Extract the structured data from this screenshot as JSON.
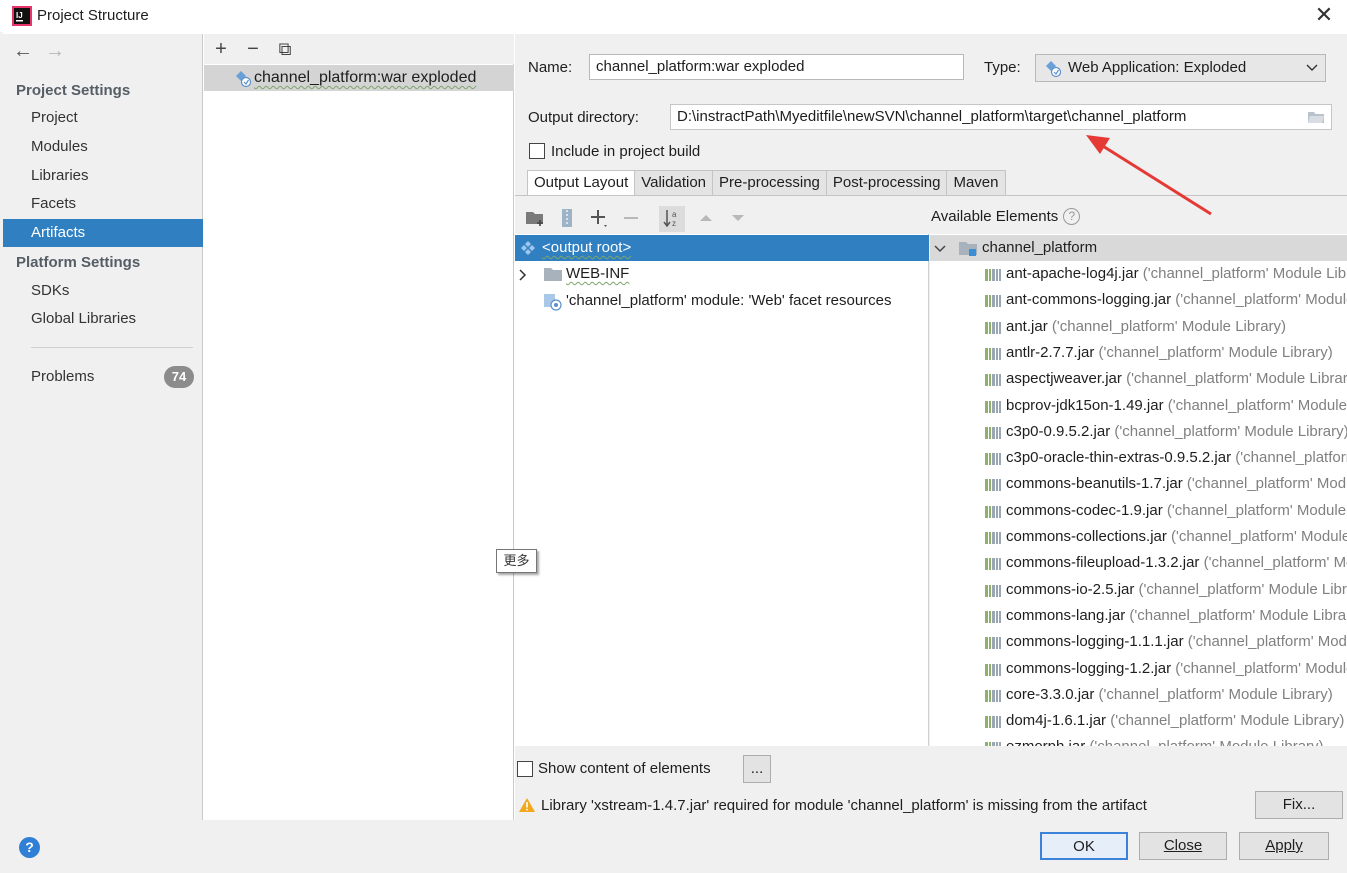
{
  "window": {
    "title": "Project Structure",
    "close": "✕"
  },
  "sidebar": {
    "back": "←",
    "forward": "→",
    "project_settings_header": "Project Settings",
    "project_items": [
      {
        "label": "Project"
      },
      {
        "label": "Modules"
      },
      {
        "label": "Libraries"
      },
      {
        "label": "Facets"
      },
      {
        "label": "Artifacts",
        "selected": true
      }
    ],
    "platform_settings_header": "Platform Settings",
    "platform_items": [
      {
        "label": "SDKs"
      },
      {
        "label": "Global Libraries"
      }
    ],
    "problems": {
      "label": "Problems",
      "count": "74"
    }
  },
  "artifacts_panel": {
    "add": "+",
    "remove": "−",
    "copy": "⧉",
    "items": [
      {
        "label": "channel_platform:war exploded"
      }
    ]
  },
  "detail": {
    "name_label": "Name:",
    "name_value": "channel_platform:war exploded",
    "type_label": "Type:",
    "type_value": "Web Application: Exploded",
    "output_dir_label": "Output directory:",
    "output_dir_value": "D:\\instractPath\\Myeditfile\\newSVN\\channel_platform\\target\\channel_platform",
    "include_label": "Include in project build",
    "include_checked": false,
    "tabs": [
      {
        "label": "Output Layout",
        "active": true
      },
      {
        "label": "Validation"
      },
      {
        "label": "Pre-processing"
      },
      {
        "label": "Post-processing"
      },
      {
        "label": "Maven"
      }
    ]
  },
  "layout_tree": {
    "rows": [
      {
        "label": "<output root>",
        "selected": true
      },
      {
        "label": "WEB-INF"
      },
      {
        "label": "'channel_platform' module: 'Web' facet resources"
      }
    ]
  },
  "available": {
    "header": "Available Elements",
    "help": "?",
    "root": "channel_platform",
    "items": [
      {
        "name": "ant-apache-log4j.jar",
        "suffix": " ('channel_platform' Module Library)"
      },
      {
        "name": "ant-commons-logging.jar",
        "suffix": " ('channel_platform' Module Library)"
      },
      {
        "name": "ant.jar",
        "suffix": " ('channel_platform' Module Library)"
      },
      {
        "name": "antlr-2.7.7.jar",
        "suffix": " ('channel_platform' Module Library)"
      },
      {
        "name": "aspectjweaver.jar",
        "suffix": " ('channel_platform' Module Library)"
      },
      {
        "name": "bcprov-jdk15on-1.49.jar",
        "suffix": " ('channel_platform' Module Library)"
      },
      {
        "name": "c3p0-0.9.5.2.jar",
        "suffix": " ('channel_platform' Module Library)"
      },
      {
        "name": "c3p0-oracle-thin-extras-0.9.5.2.jar",
        "suffix": " ('channel_platform' Module Library)"
      },
      {
        "name": "commons-beanutils-1.7.jar",
        "suffix": " ('channel_platform' Module Library)"
      },
      {
        "name": "commons-codec-1.9.jar",
        "suffix": " ('channel_platform' Module Library)"
      },
      {
        "name": "commons-collections.jar",
        "suffix": " ('channel_platform' Module Library)"
      },
      {
        "name": "commons-fileupload-1.3.2.jar",
        "suffix": " ('channel_platform' Module Library)"
      },
      {
        "name": "commons-io-2.5.jar",
        "suffix": " ('channel_platform' Module Library)"
      },
      {
        "name": "commons-lang.jar",
        "suffix": " ('channel_platform' Module Library)"
      },
      {
        "name": "commons-logging-1.1.1.jar",
        "suffix": " ('channel_platform' Module Library)"
      },
      {
        "name": "commons-logging-1.2.jar",
        "suffix": " ('channel_platform' Module Library)"
      },
      {
        "name": "core-3.3.0.jar",
        "suffix": " ('channel_platform' Module Library)"
      },
      {
        "name": "dom4j-1.6.1.jar",
        "suffix": " ('channel_platform' Module Library)"
      },
      {
        "name": "ezmorph.jar",
        "suffix": " ('channel_platform' Module Library)"
      }
    ]
  },
  "options": {
    "show_content_label": "Show content of elements",
    "ellipsis": "...",
    "warning": "Library 'xstream-1.4.7.jar' required for module 'channel_platform' is missing from the artifact",
    "fix": "Fix..."
  },
  "tooltip": "更多",
  "footer": {
    "help": "?",
    "ok": "OK",
    "close": "Close",
    "apply": "Apply"
  },
  "colors": {
    "selection": "#2f7fc1",
    "panel": "#f0f0f0",
    "arrow": "#e53935"
  }
}
